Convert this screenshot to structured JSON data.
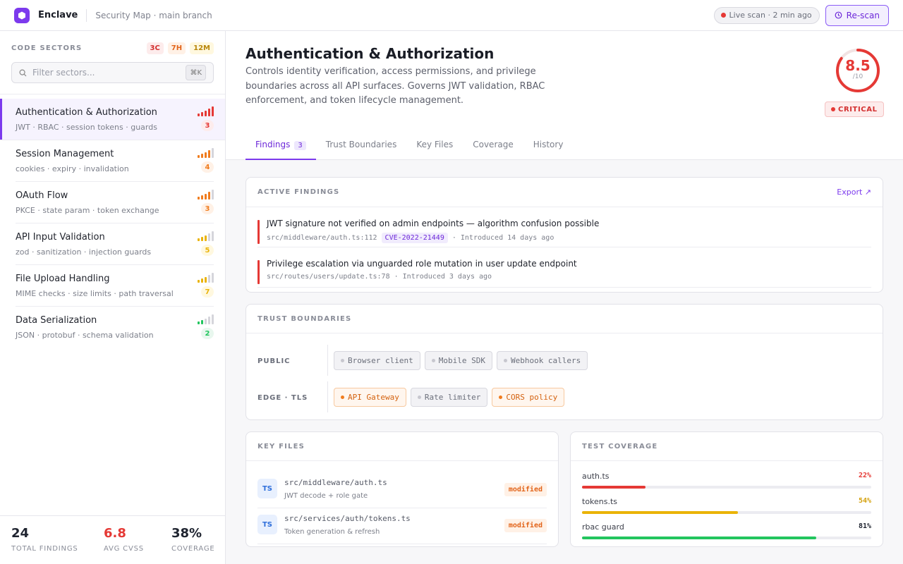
{
  "app": {
    "name": "Enclave",
    "breadcrumb": "Security Map · main branch",
    "live_scan": "Live scan · 2 min ago",
    "rescan_label": "Re-scan",
    "accent": "#7c3aed"
  },
  "sidebar": {
    "title": "CODE SECTORS",
    "counts": {
      "critical": "3C",
      "high": "7H",
      "medium": "12M"
    },
    "search_placeholder": "Filter sectors...",
    "search_shortcut": "⌘K",
    "sectors": [
      {
        "name": "Authentication & Authorization",
        "tags": "JWT · RBAC · session tokens · guards",
        "count": "3",
        "risk_level": 5,
        "color": "#e53935",
        "badge_bg": "#fdecec"
      },
      {
        "name": "Session Management",
        "tags": "cookies · expiry · invalidation",
        "count": "4",
        "risk_level": 4,
        "color": "#f07c1e",
        "badge_bg": "#fff1e6"
      },
      {
        "name": "OAuth Flow",
        "tags": "PKCE · state param · token exchange",
        "count": "3",
        "risk_level": 4,
        "color": "#f07c1e",
        "badge_bg": "#fff1e6"
      },
      {
        "name": "API Input Validation",
        "tags": "zod · sanitization · injection guards",
        "count": "5",
        "risk_level": 3,
        "color": "#eab308",
        "badge_bg": "#fff8df"
      },
      {
        "name": "File Upload Handling",
        "tags": "MIME checks · size limits · path traversal",
        "count": "7",
        "risk_level": 3,
        "color": "#eab308",
        "badge_bg": "#fff8df"
      },
      {
        "name": "Data Serialization",
        "tags": "JSON · protobuf · schema validation",
        "count": "2",
        "risk_level": 2,
        "color": "#22c55e",
        "badge_bg": "#e8f7ee"
      }
    ],
    "stats": [
      {
        "value": "24",
        "label": "TOTAL FINDINGS",
        "color": "#1f2430"
      },
      {
        "value": "6.8",
        "label": "AVG CVSS",
        "color": "#e53935"
      },
      {
        "value": "38%",
        "label": "COVERAGE",
        "color": "#1f2430"
      }
    ]
  },
  "main": {
    "title": "Authentication & Authorization",
    "description": "Controls identity verification, access permissions, and privilege boundaries across all API surfaces. Governs JWT validation, RBAC enforcement, and token lifecycle management.",
    "score": {
      "value": "8.5",
      "max": "/10",
      "fraction": 0.85,
      "severity": "CRITICAL"
    },
    "tabs": [
      {
        "label": "Findings",
        "count": "3"
      },
      {
        "label": "Trust Boundaries"
      },
      {
        "label": "Key Files"
      },
      {
        "label": "Coverage"
      },
      {
        "label": "History"
      }
    ],
    "findings": {
      "title": "ACTIVE FINDINGS",
      "export_label": "Export ↗",
      "items": [
        {
          "title": "JWT signature not verified on admin endpoints — algorithm confusion possible",
          "location": "src/middleware/auth.ts:112",
          "cve": "CVE-2022-21449",
          "introduced": "· Introduced 14 days ago"
        },
        {
          "title": "Privilege escalation via unguarded role mutation in user update endpoint",
          "location": "src/routes/users/update.ts:78",
          "introduced": "· Introduced 3 days ago"
        }
      ]
    },
    "trust_boundaries": {
      "title": "TRUST BOUNDARIES",
      "rows": [
        {
          "label": "PUBLIC",
          "chips": [
            {
              "text": "Browser client",
              "warn": false
            },
            {
              "text": "Mobile SDK",
              "warn": false
            },
            {
              "text": "Webhook callers",
              "warn": false
            }
          ]
        },
        {
          "label": "EDGE · TLS",
          "chips": [
            {
              "text": "API Gateway",
              "warn": true
            },
            {
              "text": "Rate limiter",
              "warn": false
            },
            {
              "text": "CORS policy",
              "warn": true
            }
          ]
        }
      ]
    },
    "key_files": {
      "title": "KEY FILES",
      "items": [
        {
          "lang": "TS",
          "path": "src/middleware/auth.ts",
          "desc": "JWT decode + role gate",
          "status": "modified"
        },
        {
          "lang": "TS",
          "path": "src/services/auth/tokens.ts",
          "desc": "Token generation & refresh",
          "status": "modified"
        }
      ]
    },
    "coverage": {
      "title": "TEST COVERAGE",
      "items": [
        {
          "name": "auth.ts",
          "pct_label": "22%",
          "fraction": 0.22,
          "color": "#e53935"
        },
        {
          "name": "tokens.ts",
          "pct_label": "54%",
          "fraction": 0.54,
          "color": "#eab308"
        },
        {
          "name": "rbac guard",
          "pct_label": "81%",
          "fraction": 0.81,
          "color": "#22c55e"
        }
      ]
    }
  }
}
